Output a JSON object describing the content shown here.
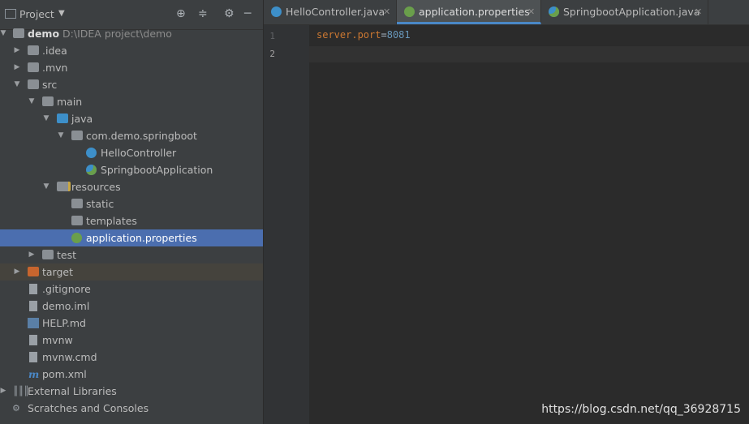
{
  "project_panel": {
    "title": "Project",
    "header_icons": [
      "crosshair-icon",
      "collapse-icon",
      "gear-icon",
      "minimize-icon"
    ],
    "root": {
      "name": "demo",
      "path": "D:\\IDEA project\\demo"
    },
    "items": [
      {
        "label": ".idea"
      },
      {
        "label": ".mvn"
      },
      {
        "label": "src"
      },
      {
        "label": "main"
      },
      {
        "label": "java"
      },
      {
        "label": "com.demo.springboot"
      },
      {
        "label": "HelloController"
      },
      {
        "label": "SpringbootApplication"
      },
      {
        "label": "resources"
      },
      {
        "label": "static"
      },
      {
        "label": "templates"
      },
      {
        "label": "application.properties"
      },
      {
        "label": "test"
      },
      {
        "label": "target"
      },
      {
        "label": ".gitignore"
      },
      {
        "label": "demo.iml"
      },
      {
        "label": "HELP.md"
      },
      {
        "label": "mvnw"
      },
      {
        "label": "mvnw.cmd"
      },
      {
        "label": "pom.xml"
      },
      {
        "label": "External Libraries"
      },
      {
        "label": "Scratches and Consoles"
      }
    ]
  },
  "editor": {
    "tabs": [
      {
        "label": "HelloController.java"
      },
      {
        "label": "application.properties"
      },
      {
        "label": "SpringbootApplication.java"
      }
    ],
    "line_numbers": [
      "1",
      "2"
    ],
    "code": {
      "key": "server.port",
      "eq": "=",
      "value": "8081"
    }
  },
  "watermark": "https://blog.csdn.net/qq_36928715",
  "colors": {
    "panel": "#3c3f41",
    "editor": "#2b2b2b",
    "selection": "#4b6eaf",
    "accent": "#4a88c7"
  }
}
